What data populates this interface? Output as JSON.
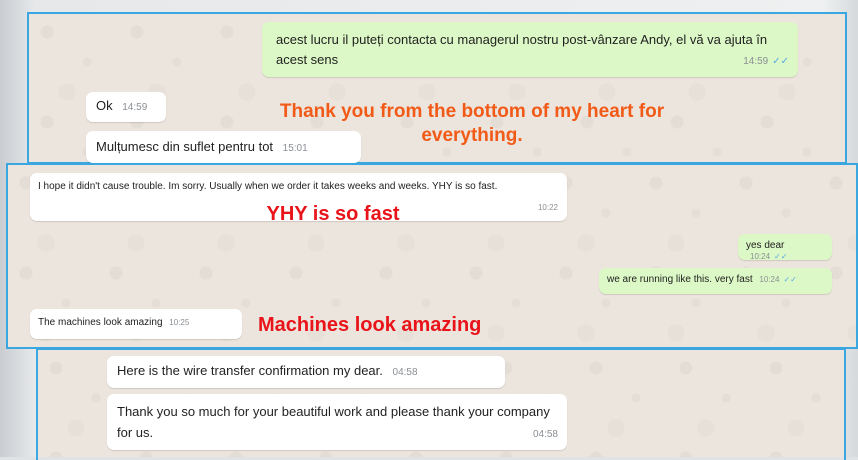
{
  "colors": {
    "incoming": "#ffffff",
    "outgoing": "#dcf8c6",
    "frame": "#3aa7e0",
    "annotation_orange": "#f25a17",
    "annotation_red": "#e8141a",
    "read_ticks": "#58a9e8"
  },
  "top_section": {
    "outgoing_message": {
      "text": "acest lucru il puteți contacta cu managerul nostru post-vânzare Andy, el vă va ajuta în acest sens",
      "time": "14:59",
      "status_icon": "double-check-icon"
    },
    "incoming_ok": {
      "text": "Ok",
      "time": "14:59"
    },
    "incoming_thanks": {
      "text": "Mulțumesc din suflet pentru tot",
      "time": "15:01"
    },
    "annotation": "Thank you from the bottom of my heart for everything."
  },
  "middle_section": {
    "incoming_trouble": {
      "text": "I hope it didn't cause trouble. Im sorry. Usually when we order  it takes weeks and weeks. YHY is so fast.",
      "time": "10:22"
    },
    "outgoing_yes": {
      "text": "yes dear",
      "time": "10:24",
      "status_icon": "double-check-icon"
    },
    "outgoing_running": {
      "text": "we are running like this. very fast",
      "time": "10:24",
      "status_icon": "double-check-icon"
    },
    "incoming_machines": {
      "text": "The machines look amazing",
      "time": "10:25"
    },
    "annotation_fast": "YHY is so fast",
    "annotation_machines": "Machines look amazing"
  },
  "bottom_section": {
    "incoming_wire": {
      "text": "Here is the wire transfer confirmation my dear.",
      "time": "04:58"
    },
    "incoming_thankyou": {
      "text": "Thank you so much for your beautiful work and please thank your company for us.",
      "time": "04:58"
    }
  }
}
